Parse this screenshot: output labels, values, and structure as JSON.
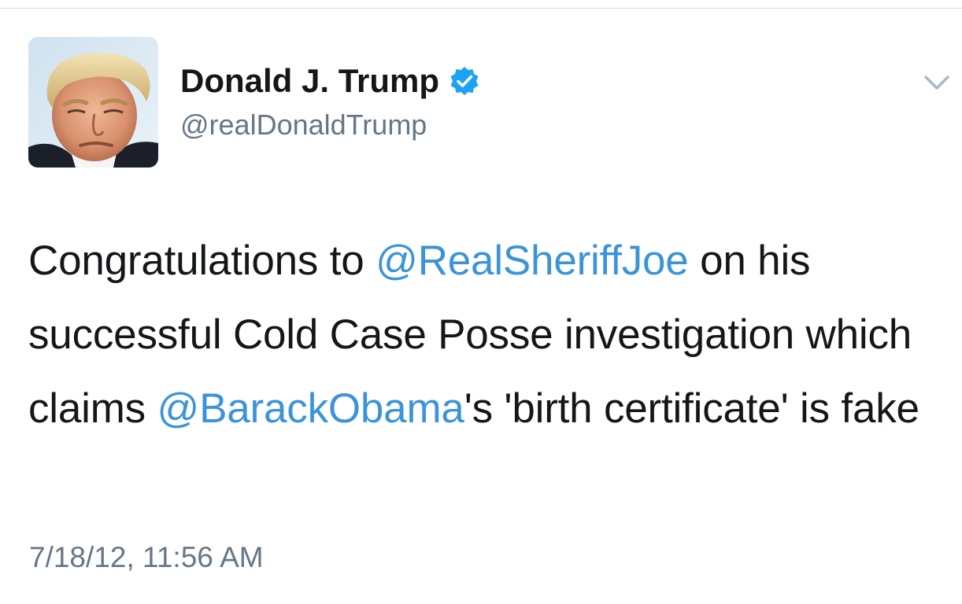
{
  "tweet": {
    "author": {
      "display_name": "Donald J. Trump",
      "handle": "@realDonaldTrump",
      "verified": true
    },
    "text": {
      "part1": "Congratulations to ",
      "mention1": "@RealSheriffJoe",
      "part2": " on his successful Cold Case Posse investigation which claims ",
      "mention2": "@BarackObama",
      "part3": "'s 'birth certificate' is fake"
    },
    "timestamp": "7/18/12, 11:56 AM"
  },
  "icons": {
    "verified": "verified-badge-icon",
    "menu": "chevron-down-icon"
  },
  "colors": {
    "link": "#3b94d9",
    "verified": "#1da1f2",
    "secondary_text": "#657786",
    "primary_text": "#14171a"
  }
}
